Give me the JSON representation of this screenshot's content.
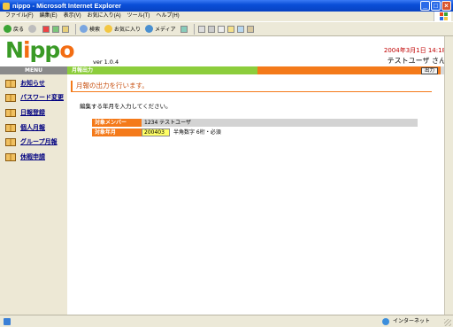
{
  "window": {
    "title": "nippo - Microsoft Internet Explorer"
  },
  "menubar": [
    "ファイル(F)",
    "編集(E)",
    "表示(V)",
    "お気に入り(A)",
    "ツール(T)",
    "ヘルプ(H)"
  ],
  "toolbar": {
    "back_label": "戻る",
    "search_label": "検索",
    "favorites_label": "お気に入り",
    "media_label": "メディア"
  },
  "header": {
    "logo_parts": [
      "N",
      "i",
      "pp",
      "o"
    ],
    "version": "ver 1.0.4",
    "datetime": "2004年3月1日 14:18",
    "user": "テストユーザ さん"
  },
  "sidebar": {
    "heading": "MENU",
    "items": [
      {
        "label": "お知らせ"
      },
      {
        "label": "パスワード変更"
      },
      {
        "label": "日報登録"
      },
      {
        "label": "個人月報"
      },
      {
        "label": "グループ月報"
      },
      {
        "label": "休暇申請"
      }
    ]
  },
  "main": {
    "section_bar": "月報出力",
    "logout_label": "出力",
    "title": "月報の出力を行います。",
    "instruction": "編集する年月を入力してください。",
    "member_label": "対象メンバー",
    "member_value": "1234 テストユーザ",
    "yearmonth_label": "対象年月",
    "yearmonth_value": "200403",
    "yearmonth_hint": "半角数字 6桁・必須"
  },
  "statusbar": {
    "zone": "インターネット"
  },
  "colors": {
    "accent_orange": "#f47a1a",
    "accent_green": "#8ccd3c",
    "date_red": "#c00000"
  }
}
